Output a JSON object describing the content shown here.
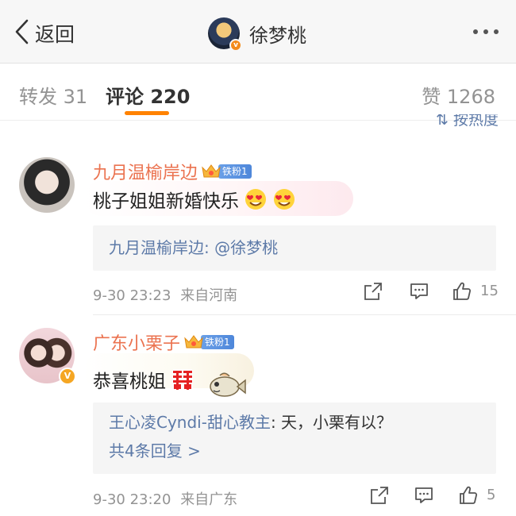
{
  "nav": {
    "back_label": "返回",
    "title": "徐梦桃"
  },
  "tabs": [
    {
      "label": "转发 31"
    },
    {
      "label": "评论 220"
    },
    {
      "label": "赞 1268"
    }
  ],
  "sort_label": "按热度",
  "comments": [
    {
      "username": "九月温榆岸边",
      "fan_badge": "铁粉1",
      "text": "桃子姐姐新婚快乐",
      "emojis": [
        "heart-eyes-emoji",
        "heart-eyes-emoji"
      ],
      "reply": {
        "user": "九月温榆岸边",
        "text": ": @徐梦桃"
      },
      "time": "9-30 23:23",
      "source": "来自河南",
      "likes": "15"
    },
    {
      "username": "广东小栗子",
      "fan_badge": "铁粉1",
      "verified": "V",
      "text": "恭喜桃姐",
      "emojis": [
        "double-happiness-emoji",
        "fish-sticker"
      ],
      "reply": {
        "user": "王心凌Cyndi-甜心教主",
        "text": ": 天，小栗有以？"
      },
      "reply_more": "共4条回复 >",
      "time": "9-30 23:20",
      "source": "来自广东",
      "likes": "5"
    }
  ],
  "colors": {
    "accent": "#ff8200",
    "username": "#eb7350",
    "link": "#5d7aa8",
    "muted": "#939393"
  }
}
